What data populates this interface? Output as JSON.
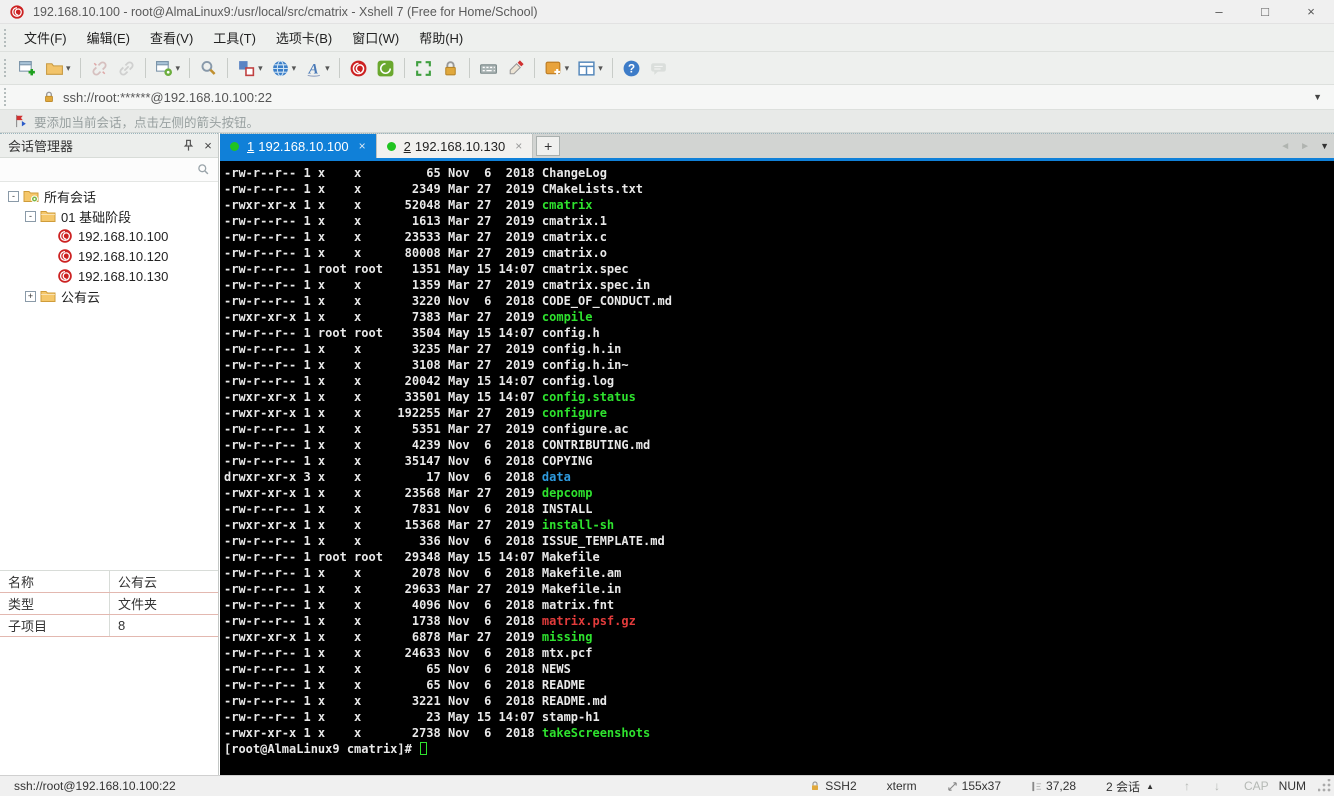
{
  "colors": {
    "accent_blue": "#1080d8",
    "status_green_dot": "#21c421",
    "terminal_text": "#e9e9e9",
    "terminal_green": "#2ee22e",
    "terminal_blue": "#2e9ade",
    "terminal_red": "#e23b3b"
  },
  "window": {
    "title": "192.168.10.100 - root@AlmaLinux9:/usr/local/src/cmatrix - Xshell 7 (Free for Home/School)",
    "controls": {
      "minimize": "–",
      "maximize": "□",
      "close": "×"
    }
  },
  "menu": {
    "items": [
      "文件(F)",
      "编辑(E)",
      "查看(V)",
      "工具(T)",
      "选项卡(B)",
      "窗口(W)",
      "帮助(H)"
    ]
  },
  "toolbar": {
    "items": [
      {
        "name": "new-session"
      },
      {
        "name": "open-session",
        "dropdown": true
      },
      "sep",
      {
        "name": "disconnect",
        "disabled": true
      },
      {
        "name": "reconnect",
        "disabled": true
      },
      "sep",
      {
        "name": "session-properties",
        "dropdown": true
      },
      "sep",
      {
        "name": "find"
      },
      "sep",
      {
        "name": "layout",
        "dropdown": true
      },
      {
        "name": "web",
        "dropdown": true
      },
      {
        "name": "font",
        "dropdown": true
      },
      "sep",
      {
        "name": "xshell"
      },
      {
        "name": "xftp"
      },
      "sep",
      {
        "name": "fullscreen"
      },
      {
        "name": "lock"
      },
      "sep",
      {
        "name": "keyboard"
      },
      {
        "name": "highlighter"
      },
      "sep",
      {
        "name": "new-transfer",
        "dropdown": true
      },
      {
        "name": "tile",
        "dropdown": true
      },
      "sep",
      {
        "name": "help"
      },
      {
        "name": "chat",
        "disabled": true
      }
    ]
  },
  "address_bar": {
    "value": "ssh://root:******@192.168.10.100:22"
  },
  "notification": {
    "text": "要添加当前会话，点击左侧的箭头按钮。"
  },
  "session_manager": {
    "title": "会话管理器",
    "tree": [
      {
        "level": 0,
        "expander": "-",
        "icon": "folder-root",
        "label": "所有会话"
      },
      {
        "level": 1,
        "expander": "-",
        "icon": "folder",
        "label": "01 基础阶段"
      },
      {
        "level": 2,
        "expander": null,
        "icon": "session",
        "label": "192.168.10.100"
      },
      {
        "level": 2,
        "expander": null,
        "icon": "session",
        "label": "192.168.10.120"
      },
      {
        "level": 2,
        "expander": null,
        "icon": "session",
        "label": "192.168.10.130"
      },
      {
        "level": 1,
        "expander": "+",
        "icon": "folder",
        "label": "公有云"
      }
    ]
  },
  "properties_panel": {
    "rows": [
      {
        "key": "名称",
        "value": "公有云"
      },
      {
        "key": "类型",
        "value": "文件夹"
      },
      {
        "key": "子项目",
        "value": "8"
      }
    ]
  },
  "tabs": {
    "items": [
      {
        "index_label": "1",
        "label": "192.168.10.100",
        "active": true
      },
      {
        "index_label": "2",
        "label": "192.168.10.130",
        "active": false
      }
    ],
    "new_tab_label": "+"
  },
  "terminal": {
    "lines": [
      {
        "perms": "-rw-r--r--",
        "links": "1",
        "owner": "x",
        "group": "x",
        "size": "65",
        "date": "Nov  6  2018",
        "name": "ChangeLog",
        "type": "file"
      },
      {
        "perms": "-rw-r--r--",
        "links": "1",
        "owner": "x",
        "group": "x",
        "size": "2349",
        "date": "Mar 27  2019",
        "name": "CMakeLists.txt",
        "type": "file"
      },
      {
        "perms": "-rwxr-xr-x",
        "links": "1",
        "owner": "x",
        "group": "x",
        "size": "52048",
        "date": "Mar 27  2019",
        "name": "cmatrix",
        "type": "exec"
      },
      {
        "perms": "-rw-r--r--",
        "links": "1",
        "owner": "x",
        "group": "x",
        "size": "1613",
        "date": "Mar 27  2019",
        "name": "cmatrix.1",
        "type": "file"
      },
      {
        "perms": "-rw-r--r--",
        "links": "1",
        "owner": "x",
        "group": "x",
        "size": "23533",
        "date": "Mar 27  2019",
        "name": "cmatrix.c",
        "type": "file"
      },
      {
        "perms": "-rw-r--r--",
        "links": "1",
        "owner": "x",
        "group": "x",
        "size": "80008",
        "date": "Mar 27  2019",
        "name": "cmatrix.o",
        "type": "file"
      },
      {
        "perms": "-rw-r--r--",
        "links": "1",
        "owner": "root",
        "group": "root",
        "size": "1351",
        "date": "May 15 14:07",
        "name": "cmatrix.spec",
        "type": "file"
      },
      {
        "perms": "-rw-r--r--",
        "links": "1",
        "owner": "x",
        "group": "x",
        "size": "1359",
        "date": "Mar 27  2019",
        "name": "cmatrix.spec.in",
        "type": "file"
      },
      {
        "perms": "-rw-r--r--",
        "links": "1",
        "owner": "x",
        "group": "x",
        "size": "3220",
        "date": "Nov  6  2018",
        "name": "CODE_OF_CONDUCT.md",
        "type": "file"
      },
      {
        "perms": "-rwxr-xr-x",
        "links": "1",
        "owner": "x",
        "group": "x",
        "size": "7383",
        "date": "Mar 27  2019",
        "name": "compile",
        "type": "exec"
      },
      {
        "perms": "-rw-r--r--",
        "links": "1",
        "owner": "root",
        "group": "root",
        "size": "3504",
        "date": "May 15 14:07",
        "name": "config.h",
        "type": "file"
      },
      {
        "perms": "-rw-r--r--",
        "links": "1",
        "owner": "x",
        "group": "x",
        "size": "3235",
        "date": "Mar 27  2019",
        "name": "config.h.in",
        "type": "file"
      },
      {
        "perms": "-rw-r--r--",
        "links": "1",
        "owner": "x",
        "group": "x",
        "size": "3108",
        "date": "Mar 27  2019",
        "name": "config.h.in~",
        "type": "file"
      },
      {
        "perms": "-rw-r--r--",
        "links": "1",
        "owner": "x",
        "group": "x",
        "size": "20042",
        "date": "May 15 14:07",
        "name": "config.log",
        "type": "file"
      },
      {
        "perms": "-rwxr-xr-x",
        "links": "1",
        "owner": "x",
        "group": "x",
        "size": "33501",
        "date": "May 15 14:07",
        "name": "config.status",
        "type": "exec"
      },
      {
        "perms": "-rwxr-xr-x",
        "links": "1",
        "owner": "x",
        "group": "x",
        "size": "192255",
        "date": "Mar 27  2019",
        "name": "configure",
        "type": "exec"
      },
      {
        "perms": "-rw-r--r--",
        "links": "1",
        "owner": "x",
        "group": "x",
        "size": "5351",
        "date": "Mar 27  2019",
        "name": "configure.ac",
        "type": "file"
      },
      {
        "perms": "-rw-r--r--",
        "links": "1",
        "owner": "x",
        "group": "x",
        "size": "4239",
        "date": "Nov  6  2018",
        "name": "CONTRIBUTING.md",
        "type": "file"
      },
      {
        "perms": "-rw-r--r--",
        "links": "1",
        "owner": "x",
        "group": "x",
        "size": "35147",
        "date": "Nov  6  2018",
        "name": "COPYING",
        "type": "file"
      },
      {
        "perms": "drwxr-xr-x",
        "links": "3",
        "owner": "x",
        "group": "x",
        "size": "17",
        "date": "Nov  6  2018",
        "name": "data",
        "type": "dir"
      },
      {
        "perms": "-rwxr-xr-x",
        "links": "1",
        "owner": "x",
        "group": "x",
        "size": "23568",
        "date": "Mar 27  2019",
        "name": "depcomp",
        "type": "exec"
      },
      {
        "perms": "-rw-r--r--",
        "links": "1",
        "owner": "x",
        "group": "x",
        "size": "7831",
        "date": "Nov  6  2018",
        "name": "INSTALL",
        "type": "file"
      },
      {
        "perms": "-rwxr-xr-x",
        "links": "1",
        "owner": "x",
        "group": "x",
        "size": "15368",
        "date": "Mar 27  2019",
        "name": "install-sh",
        "type": "exec"
      },
      {
        "perms": "-rw-r--r--",
        "links": "1",
        "owner": "x",
        "group": "x",
        "size": "336",
        "date": "Nov  6  2018",
        "name": "ISSUE_TEMPLATE.md",
        "type": "file"
      },
      {
        "perms": "-rw-r--r--",
        "links": "1",
        "owner": "root",
        "group": "root",
        "size": "29348",
        "date": "May 15 14:07",
        "name": "Makefile",
        "type": "file"
      },
      {
        "perms": "-rw-r--r--",
        "links": "1",
        "owner": "x",
        "group": "x",
        "size": "2078",
        "date": "Nov  6  2018",
        "name": "Makefile.am",
        "type": "file"
      },
      {
        "perms": "-rw-r--r--",
        "links": "1",
        "owner": "x",
        "group": "x",
        "size": "29633",
        "date": "Mar 27  2019",
        "name": "Makefile.in",
        "type": "file"
      },
      {
        "perms": "-rw-r--r--",
        "links": "1",
        "owner": "x",
        "group": "x",
        "size": "4096",
        "date": "Nov  6  2018",
        "name": "matrix.fnt",
        "type": "file"
      },
      {
        "perms": "-rw-r--r--",
        "links": "1",
        "owner": "x",
        "group": "x",
        "size": "1738",
        "date": "Nov  6  2018",
        "name": "matrix.psf.gz",
        "type": "archive"
      },
      {
        "perms": "-rwxr-xr-x",
        "links": "1",
        "owner": "x",
        "group": "x",
        "size": "6878",
        "date": "Mar 27  2019",
        "name": "missing",
        "type": "exec"
      },
      {
        "perms": "-rw-r--r--",
        "links": "1",
        "owner": "x",
        "group": "x",
        "size": "24633",
        "date": "Nov  6  2018",
        "name": "mtx.pcf",
        "type": "file"
      },
      {
        "perms": "-rw-r--r--",
        "links": "1",
        "owner": "x",
        "group": "x",
        "size": "65",
        "date": "Nov  6  2018",
        "name": "NEWS",
        "type": "file"
      },
      {
        "perms": "-rw-r--r--",
        "links": "1",
        "owner": "x",
        "group": "x",
        "size": "65",
        "date": "Nov  6  2018",
        "name": "README",
        "type": "file"
      },
      {
        "perms": "-rw-r--r--",
        "links": "1",
        "owner": "x",
        "group": "x",
        "size": "3221",
        "date": "Nov  6  2018",
        "name": "README.md",
        "type": "file"
      },
      {
        "perms": "-rw-r--r--",
        "links": "1",
        "owner": "x",
        "group": "x",
        "size": "23",
        "date": "May 15 14:07",
        "name": "stamp-h1",
        "type": "file"
      },
      {
        "perms": "-rwxr-xr-x",
        "links": "1",
        "owner": "x",
        "group": "x",
        "size": "2738",
        "date": "Nov  6  2018",
        "name": "takeScreenshots",
        "type": "exec"
      }
    ],
    "prompt": "[root@AlmaLinux9 cmatrix]# "
  },
  "status_bar": {
    "left": "ssh://root@192.168.10.100:22",
    "encryption": "SSH2",
    "term_type": "xterm",
    "size": "155x37",
    "cursor": "37,28",
    "sessions": "2 会话",
    "cap": "CAP",
    "num": "NUM"
  }
}
